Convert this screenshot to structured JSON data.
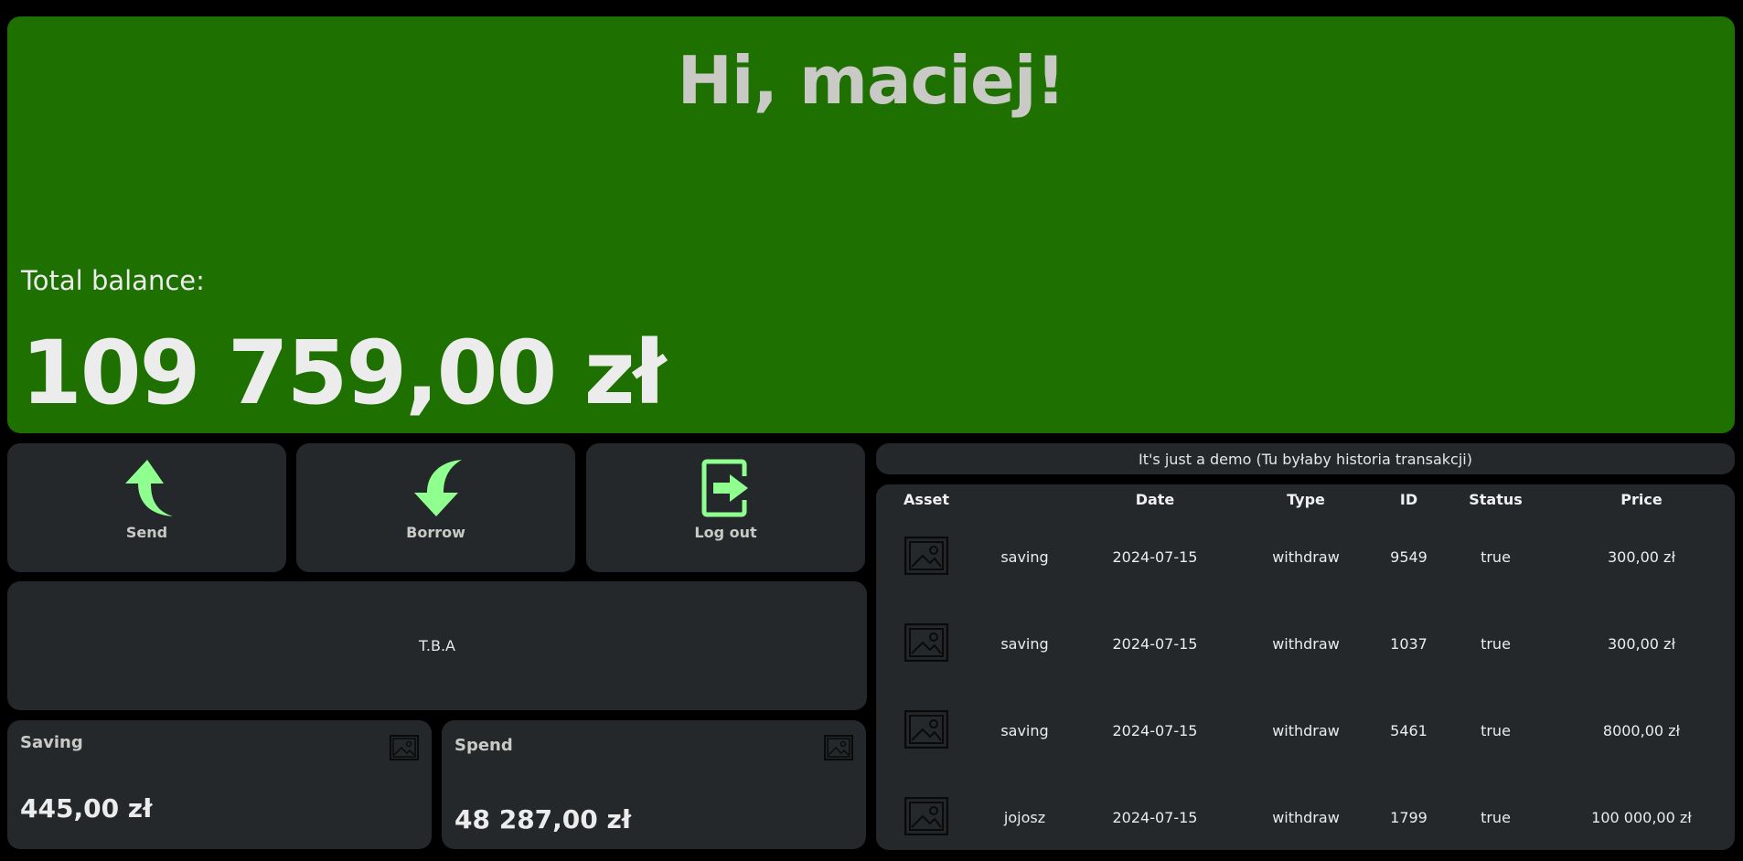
{
  "hero": {
    "greeting": "Hi, maciej!",
    "balance_label": "Total balance:",
    "balance_value": "109 759,00 zł"
  },
  "actions": {
    "send_label": "Send",
    "borrow_label": "Borrow",
    "logout_label": "Log out"
  },
  "placeholder_text": "T.B.A",
  "saving": {
    "title": "Saving",
    "value": "445,00 zł"
  },
  "spend": {
    "title": "Spend",
    "value": "48 287,00 zł"
  },
  "transactions": {
    "banner": "It's just a demo (Tu byłaby historia transakcji)",
    "headers": [
      "Asset",
      "",
      "Date",
      "Type",
      "ID",
      "Status",
      "Price"
    ],
    "rows": [
      {
        "name": "saving",
        "date": "2024-07-15",
        "type": "withdraw",
        "id": "9549",
        "status": "true",
        "price": "300,00 zł"
      },
      {
        "name": "saving",
        "date": "2024-07-15",
        "type": "withdraw",
        "id": "1037",
        "status": "true",
        "price": "300,00 zł"
      },
      {
        "name": "saving",
        "date": "2024-07-15",
        "type": "withdraw",
        "id": "5461",
        "status": "true",
        "price": "8000,00 zł"
      },
      {
        "name": "jojosz",
        "date": "2024-07-15",
        "type": "withdraw",
        "id": "1799",
        "status": "true",
        "price": "100 000,00 zł"
      }
    ]
  },
  "colors": {
    "accent_green": "#1e7000",
    "icon_green": "#8fff8f",
    "card_bg": "#25282b"
  },
  "icons": {
    "send": "arrow-up-curved-icon",
    "borrow": "arrow-down-curved-icon",
    "logout": "exit-icon",
    "asset": "image-placeholder-icon"
  }
}
